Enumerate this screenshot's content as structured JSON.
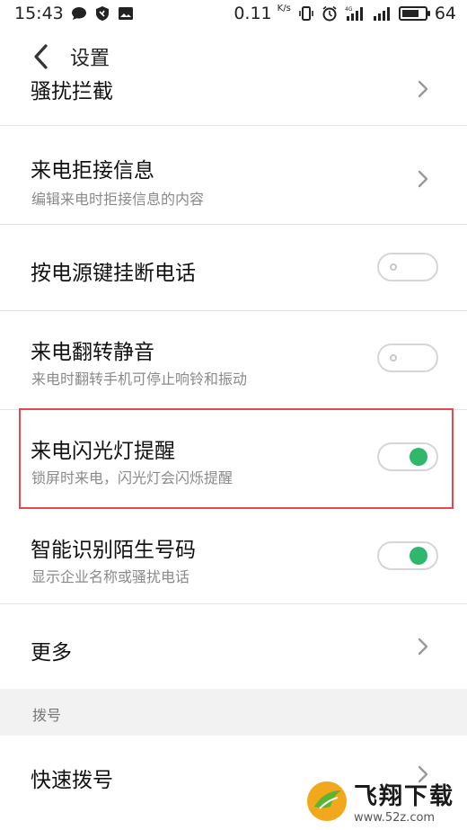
{
  "status_bar": {
    "time": "15:43",
    "net_speed": "0.11",
    "net_unit": "K/s",
    "network_type": "4G",
    "battery_level": "64"
  },
  "header": {
    "title": "设置"
  },
  "rows": [
    {
      "title": "骚扰拦截"
    },
    {
      "title": "来电拒接信息",
      "subtitle": "编辑来电时拒接信息的内容"
    },
    {
      "title": "按电源键挂断电话",
      "toggle": false
    },
    {
      "title": "来电翻转静音",
      "subtitle": "来电时翻转手机可停止响铃和振动",
      "toggle": false
    },
    {
      "title": "来电闪光灯提醒",
      "subtitle": "锁屏时来电，闪光灯会闪烁提醒",
      "toggle": true
    },
    {
      "title": "智能识别陌生号码",
      "subtitle": "显示企业名称或骚扰电话",
      "toggle": true
    },
    {
      "title": "更多"
    }
  ],
  "section": {
    "title": "拨号"
  },
  "quick_dial": {
    "title": "快速拨号"
  },
  "watermark": {
    "main": "飞翔下载",
    "sub": "www.52z.com"
  },
  "colors": {
    "toggle_on": "#2fb86b",
    "highlight": "#e8474e"
  }
}
